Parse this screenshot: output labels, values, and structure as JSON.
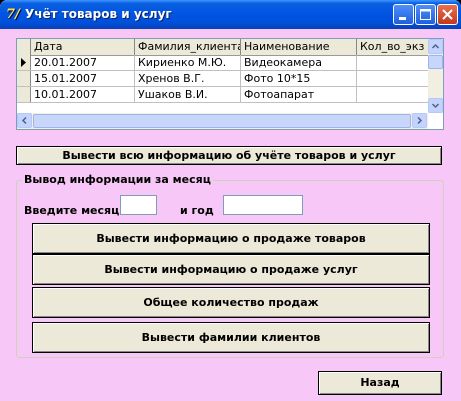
{
  "window": {
    "title": "Учёт товаров и услуг",
    "icon": "app-logo-icon"
  },
  "grid": {
    "columns": [
      "Дата",
      "Фамилия_клиента",
      "Наименование",
      "Кол_во_экз"
    ],
    "rows": [
      [
        "20.01.2007",
        "Кириенко М.Ю.",
        "Видеокамера",
        ""
      ],
      [
        "15.01.2007",
        "Хренов В.Г.",
        "Фото 10*15",
        ""
      ],
      [
        "10.01.2007",
        "Ушаков В.И.",
        "Фотоапарат",
        ""
      ]
    ]
  },
  "buttons": {
    "show_all": "Вывести всю информацию об учёте товаров и услуг",
    "goods_sales": "Вывести информацию о продаже товаров",
    "services_sales": "Вывести информацию о продаже услуг",
    "total_sales": "Общее количество продаж",
    "client_names": "Вывести фамилии клиентов",
    "back": "Назад"
  },
  "month_group": {
    "legend": "Вывод информации за месяц",
    "month_label": "Введите месяц",
    "year_label": "и год",
    "month_value": "",
    "year_value": ""
  }
}
